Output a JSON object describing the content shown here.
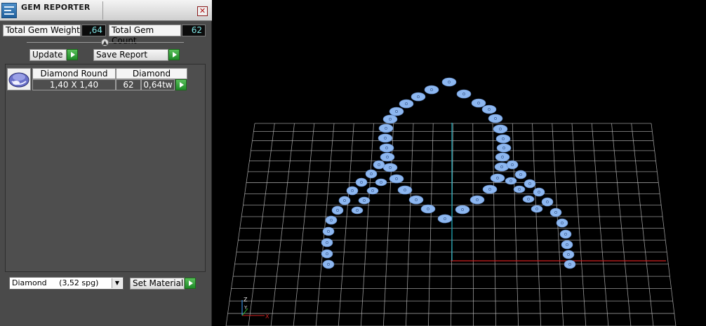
{
  "window": {
    "title": "GEM REPORTER",
    "close_label": "✕"
  },
  "summary": {
    "weight_label": "Total Gem Weight",
    "weight_value": ",64",
    "count_label": "Total Gem Count",
    "count_value": "62"
  },
  "actions": {
    "update_label": "Update",
    "save_report_label": "Save Report"
  },
  "gem_table": {
    "rows": [
      {
        "icon": "round-diamond-icon",
        "cut": "Diamond Round",
        "material": "Diamond",
        "size": "1,40 X 1,40",
        "count": "62",
        "weight": "0,64tw"
      }
    ]
  },
  "material": {
    "selected": "Diamond     (3,52 spg)",
    "set_label": "Set Material"
  },
  "viewport": {
    "axis_z_label": "Z",
    "axis_y_label": "Y",
    "axis_x_label": "X",
    "colors": {
      "grid": "#c8c8c8",
      "gem": "#8db7f0",
      "x_axis": "#d02020",
      "y_axis": "#20b0c0"
    }
  }
}
